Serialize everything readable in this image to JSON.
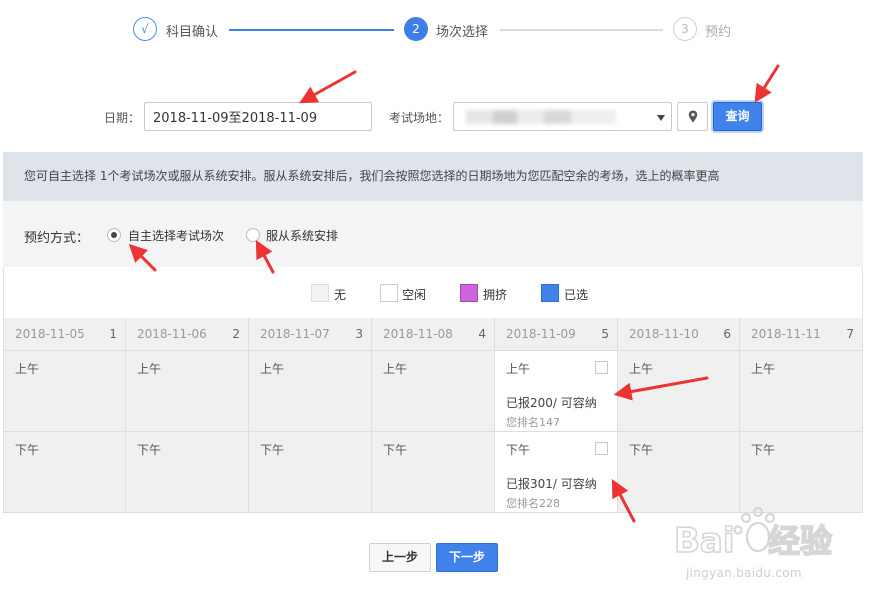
{
  "steps": [
    {
      "marker": "√",
      "label": "科目确认",
      "state": "done"
    },
    {
      "marker": "2",
      "label": "场次选择",
      "state": "active"
    },
    {
      "marker": "3",
      "label": "预约",
      "state": "todo"
    }
  ],
  "search": {
    "date_label": "日期：",
    "date_value": "2018-11-09至2018-11-09",
    "venue_label": "考试场地：",
    "location_icon": "map-pin-icon",
    "query_label": "查询"
  },
  "notice": "您可自主选择 1个考试场次或服从系统安排。服从系统安排后，我们会按照您选择的日期场地为您匹配空余的考场，选上的概率更高",
  "mode": {
    "title": "预约方式：",
    "options": [
      {
        "label": "自主选择考试场次",
        "checked": true
      },
      {
        "label": "服从系统安排",
        "checked": false
      }
    ]
  },
  "legend": [
    {
      "label": "无",
      "color": "#f2f2f2",
      "border": "#dddddd"
    },
    {
      "label": "空闲",
      "color": "#ffffff",
      "border": "#cccccc"
    },
    {
      "label": "拥挤",
      "color": "#cc66dd",
      "border": "#a24bb8"
    },
    {
      "label": "已选",
      "color": "#3f83ea",
      "border": "#2f71d6"
    }
  ],
  "calendar": {
    "days": [
      {
        "date": "2018-11-05",
        "weekday": "1"
      },
      {
        "date": "2018-11-06",
        "weekday": "2"
      },
      {
        "date": "2018-11-07",
        "weekday": "3"
      },
      {
        "date": "2018-11-08",
        "weekday": "4"
      },
      {
        "date": "2018-11-09",
        "weekday": "5"
      },
      {
        "date": "2018-11-10",
        "weekday": "6"
      },
      {
        "date": "2018-11-11",
        "weekday": "7"
      }
    ],
    "rows": [
      {
        "period": "上午",
        "available_index": 4,
        "report": "已报200/ 可容纳",
        "rank": "您排名147"
      },
      {
        "period": "下午",
        "available_index": 4,
        "report": "已报301/ 可容纳",
        "rank": "您排名228"
      }
    ]
  },
  "buttons": {
    "prev": "上一步",
    "next": "下一步"
  },
  "watermark": {
    "brand": "Baidu经验",
    "url": "jingyan.baidu.com"
  },
  "colors": {
    "accent": "#3f83ea",
    "annotation_arrow": "#ee3333"
  }
}
